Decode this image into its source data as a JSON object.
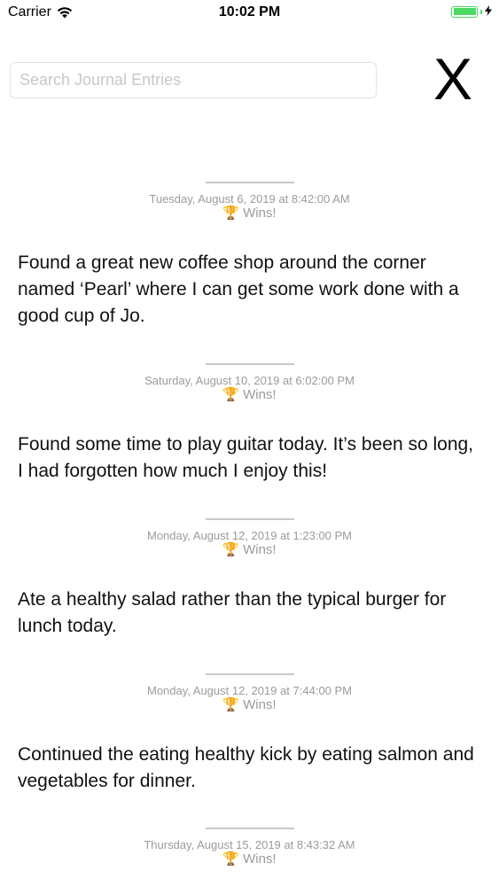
{
  "status_bar": {
    "carrier": "Carrier",
    "time": "10:02 PM",
    "battery_level": 1.0
  },
  "search": {
    "placeholder": "Search Journal Entries",
    "value": ""
  },
  "close": {
    "label": "X"
  },
  "entries": [
    {
      "date": "Tuesday, August 6, 2019 at 8:42:00 AM",
      "tag": "Wins!",
      "text": "Found a great new coffee shop around the corner named ‘Pearl’ where I can get some work done with a good cup of Jo."
    },
    {
      "date": "Saturday, August 10, 2019 at 6:02:00 PM",
      "tag": "Wins!",
      "text": "Found some time to play guitar today. It’s been so long, I had forgotten how much I enjoy this!"
    },
    {
      "date": "Monday, August 12, 2019 at 1:23:00 PM",
      "tag": "Wins!",
      "text": "Ate a healthy salad rather than the typical burger for lunch today."
    },
    {
      "date": "Monday, August 12, 2019 at 7:44:00 PM",
      "tag": "Wins!",
      "text": "Continued the eating healthy kick by eating salmon and vegetables for dinner."
    },
    {
      "date": "Thursday, August 15, 2019 at 8:43:32 AM",
      "tag": "Wins!",
      "text": ""
    }
  ],
  "colors": {
    "battery": "#4cd964",
    "meta_text": "#9b9b9b",
    "divider": "#c8c8c8"
  },
  "icons": {
    "wifi": "wifi-icon",
    "battery": "battery-icon",
    "close": "close-icon",
    "tag": "trophy-icon"
  }
}
